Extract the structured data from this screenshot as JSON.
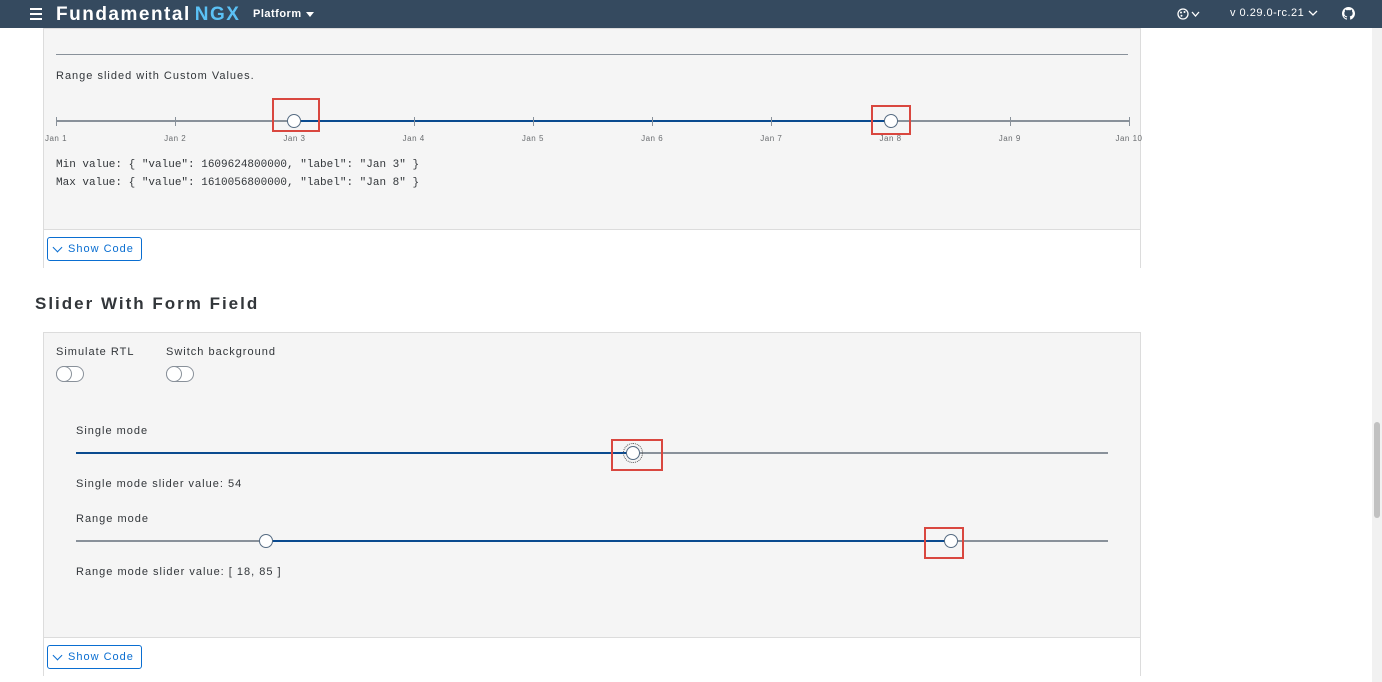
{
  "header": {
    "brand": "Fundamental",
    "brand_accent": "NGX",
    "platform_label": "Platform",
    "version": "v 0.29.0-rc.21",
    "icons": [
      "menu-icon",
      "theme-icon",
      "chevron-down-icon",
      "github-icon"
    ]
  },
  "panel1": {
    "caption": "Range slided with Custom Values.",
    "ticks": [
      "Jan 1",
      "Jan 2",
      "Jan 3",
      "Jan 4",
      "Jan 5",
      "Jan 6",
      "Jan 7",
      "Jan 8",
      "Jan 9",
      "Jan 10"
    ],
    "range_start_index": 2,
    "range_end_index": 7,
    "min_value_text": "Min value: { \"value\": 1609624800000, \"label\": \"Jan 3\" }",
    "max_value_text": "Max value: { \"value\": 1610056800000, \"label\": \"Jan 8\" }",
    "show_code": "Show Code"
  },
  "section2": {
    "title": "Slider With Form Field",
    "toggle_rtl": "Simulate RTL",
    "toggle_bg": "Switch background",
    "single_label": "Single mode",
    "single_value": 54,
    "single_value_text": "Single mode slider value: 54",
    "range_label": "Range mode",
    "range_min": 18,
    "range_max": 85,
    "range_value_text": "Range mode slider value: [ 18, 85 ]",
    "show_code": "Show Code"
  },
  "colors": {
    "header_bg": "#354a5f",
    "accent": "#5bc1f5",
    "slider_fill": "#0a4a8f",
    "highlight": "#d9473f"
  }
}
